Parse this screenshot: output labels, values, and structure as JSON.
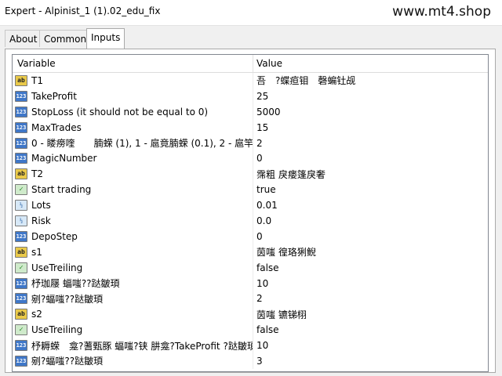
{
  "window": {
    "title": "Expert - Alpinist_1 (1).02_edu_fix",
    "watermark": "www.mt4.shop"
  },
  "tabs": [
    {
      "label": "About"
    },
    {
      "label": "Common"
    },
    {
      "label": "Inputs"
    }
  ],
  "table": {
    "columns": {
      "variable": "Variable",
      "value": "Value"
    },
    "rows": [
      {
        "icon": "string-type-icon",
        "name": "T1",
        "value": "吾　?蝶疸钼　磬蝙钍觇"
      },
      {
        "icon": "integer-type-icon",
        "name": "TakeProfit",
        "value": "25"
      },
      {
        "icon": "integer-type-icon",
        "name": "StopLoss (it should not be equal to 0)",
        "value": "5000"
      },
      {
        "icon": "integer-type-icon",
        "name": "MaxTrades",
        "value": "15"
      },
      {
        "icon": "integer-type-icon",
        "name": "0 - 䁖痨喹　　腩蝾 (1), 1 - 扈竟腩蝾 (0.1), 2 - 扈竿?...",
        "value": "2"
      },
      {
        "icon": "integer-type-icon",
        "name": "MagicNumber",
        "value": "0"
      },
      {
        "icon": "string-type-icon",
        "name": "T2",
        "value": "霈粗 戾瘘篷戾奢"
      },
      {
        "icon": "bool-type-icon",
        "name": "Start trading",
        "value": "true"
      },
      {
        "icon": "double-type-icon",
        "name": "Lots",
        "value": "0.01"
      },
      {
        "icon": "double-type-icon",
        "name": "Risk",
        "value": "0.0"
      },
      {
        "icon": "integer-type-icon",
        "name": "DepoStep",
        "value": "0"
      },
      {
        "icon": "string-type-icon",
        "name": "s1",
        "value": "茵嗤 徨珞猁鲵"
      },
      {
        "icon": "bool-type-icon",
        "name": "UseTreiling",
        "value": "false"
      },
      {
        "icon": "integer-type-icon",
        "name": "杼珈屦 蝠嗤??跶皺頊",
        "value": "10"
      },
      {
        "icon": "integer-type-icon",
        "name": "剜?蝠嗤??跶皺頊",
        "value": "2"
      },
      {
        "icon": "string-type-icon",
        "name": "s2",
        "value": "茵嗤 镳锑栩"
      },
      {
        "icon": "bool-type-icon",
        "name": "UseTreiling",
        "value": "false"
      },
      {
        "icon": "integer-type-icon",
        "name": "杼耨蝾　龛?蓍甄豚 蝠嗤?铗 肼龛?TakeProfit ?跶皺頊",
        "value": "10"
      },
      {
        "icon": "integer-type-icon",
        "name": "剜?蝠嗤??跶皺頊",
        "value": "3"
      }
    ]
  }
}
